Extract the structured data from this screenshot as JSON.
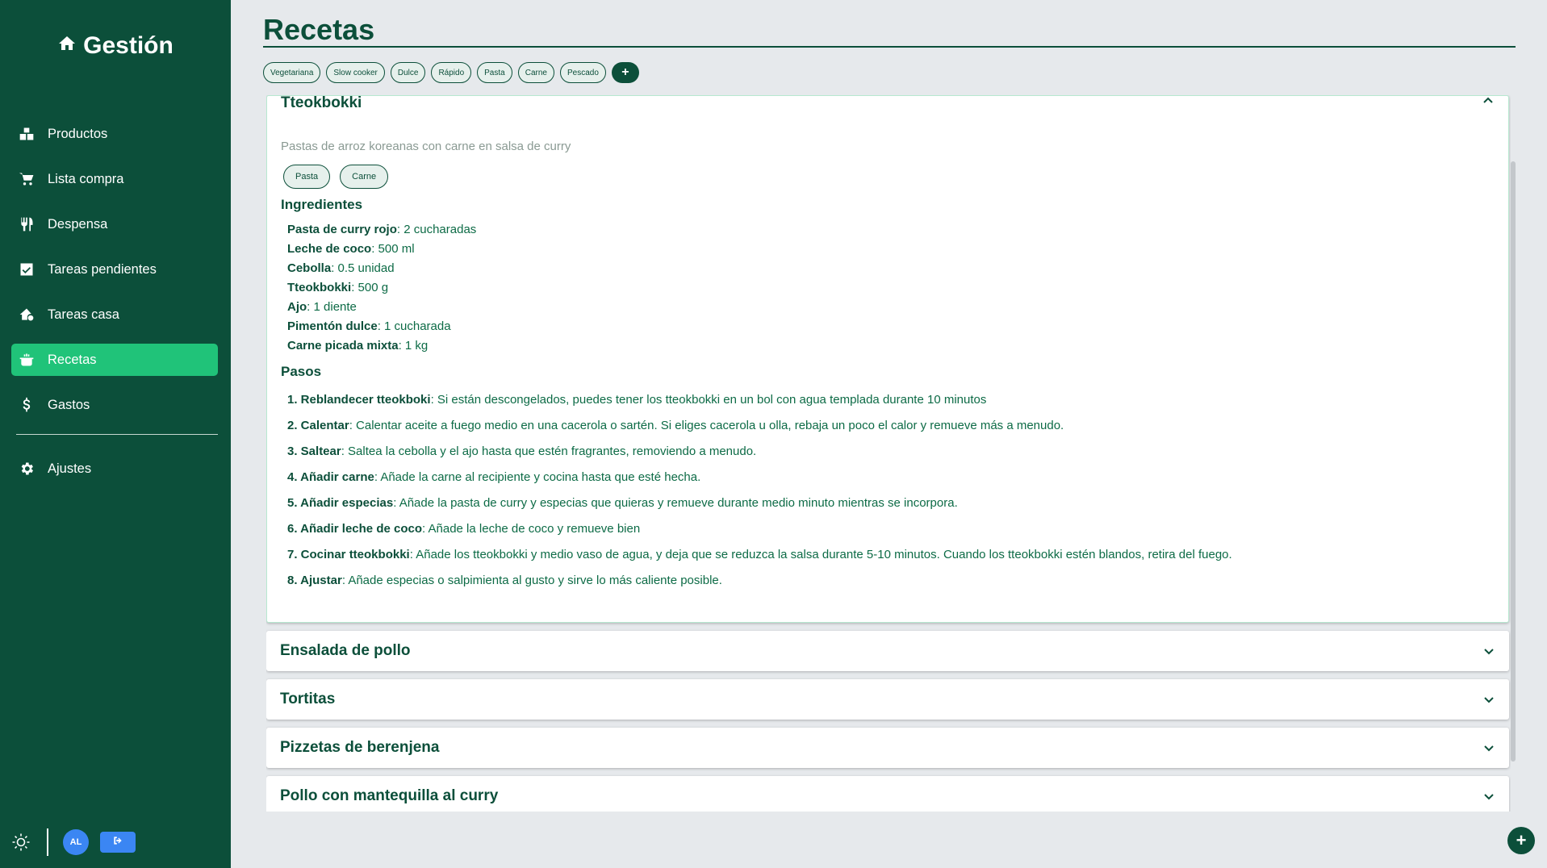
{
  "brand": {
    "title": "Gestión",
    "icon": "home-icon"
  },
  "nav": {
    "items": [
      {
        "label": "Productos",
        "icon": "boxes-icon",
        "active": false
      },
      {
        "label": "Lista compra",
        "icon": "cart-icon",
        "active": false
      },
      {
        "label": "Despensa",
        "icon": "utensils-icon",
        "active": false
      },
      {
        "label": "Tareas pendientes",
        "icon": "checkbox-icon",
        "active": false
      },
      {
        "label": "Tareas casa",
        "icon": "house-gear-icon",
        "active": false
      },
      {
        "label": "Recetas",
        "icon": "pot-icon",
        "active": true
      },
      {
        "label": "Gastos",
        "icon": "dollar-icon",
        "active": false
      }
    ],
    "settings_label": "Ajustes"
  },
  "footer": {
    "avatar_initials": "AL"
  },
  "page": {
    "title": "Recetas"
  },
  "filter_tags": [
    "Vegetariana",
    "Slow cooker",
    "Dulce",
    "Rápido",
    "Pasta",
    "Carne",
    "Pescado"
  ],
  "add_tag_label": "+",
  "expanded_recipe": {
    "title": "Tteokbokki",
    "description": "Pastas de arroz koreanas con carne en salsa de curry",
    "tags": [
      "Pasta",
      "Carne"
    ],
    "ingredients_title": "Ingredientes",
    "ingredients": [
      {
        "name": "Pasta de curry rojo",
        "qty": ": 2 cucharadas"
      },
      {
        "name": "Leche de coco",
        "qty": ": 500 ml"
      },
      {
        "name": "Cebolla",
        "qty": ": 0.5 unidad"
      },
      {
        "name": "Tteokbokki",
        "qty": ": 500 g"
      },
      {
        "name": "Ajo",
        "qty": ": 1 diente"
      },
      {
        "name": "Pimentón dulce",
        "qty": ": 1 cucharada"
      },
      {
        "name": "Carne picada mixta",
        "qty": ": 1 kg"
      }
    ],
    "steps_title": "Pasos",
    "steps": [
      {
        "title": "1. Reblandecer tteokboki",
        "text": ": Si están descongelados, puedes tener los tteokbokki en un bol con agua templada durante 10 minutos"
      },
      {
        "title": "2. Calentar",
        "text": ": Calentar aceite a fuego medio en una cacerola o sartén. Si eliges cacerola u olla, rebaja un poco el calor y remueve más a menudo."
      },
      {
        "title": "3. Saltear",
        "text": ": Saltea la cebolla y el ajo hasta que estén fragrantes, removiendo a menudo."
      },
      {
        "title": "4. Añadir carne",
        "text": ": Añade la carne al recipiente y cocina hasta que esté hecha."
      },
      {
        "title": "5. Añadir especias",
        "text": ": Añade la pasta de curry y especias que quieras y remueve durante medio minuto mientras se incorpora."
      },
      {
        "title": "6. Añadir leche de coco",
        "text": ": Añade la leche de coco y remueve bien"
      },
      {
        "title": "7. Cocinar tteokbokki",
        "text": ": Añade los tteokbokki y medio vaso de agua, y deja que se reduzca la salsa durante 5-10 minutos. Cuando los tteokbokki estén blandos, retira del fuego."
      },
      {
        "title": "8. Ajustar",
        "text": ": Añade especias o salpimienta al gusto y sirve lo más caliente posible."
      }
    ]
  },
  "collapsed_recipes": [
    "Ensalada de pollo",
    "Tortitas",
    "Pizzetas de berenjena",
    "Pollo con mantequilla al curry"
  ],
  "fab_label": "+",
  "colors": {
    "sidebar": "#0c4f3a",
    "active": "#20c379",
    "accent_blue": "#3b86f3",
    "background": "#e6e9ec"
  }
}
